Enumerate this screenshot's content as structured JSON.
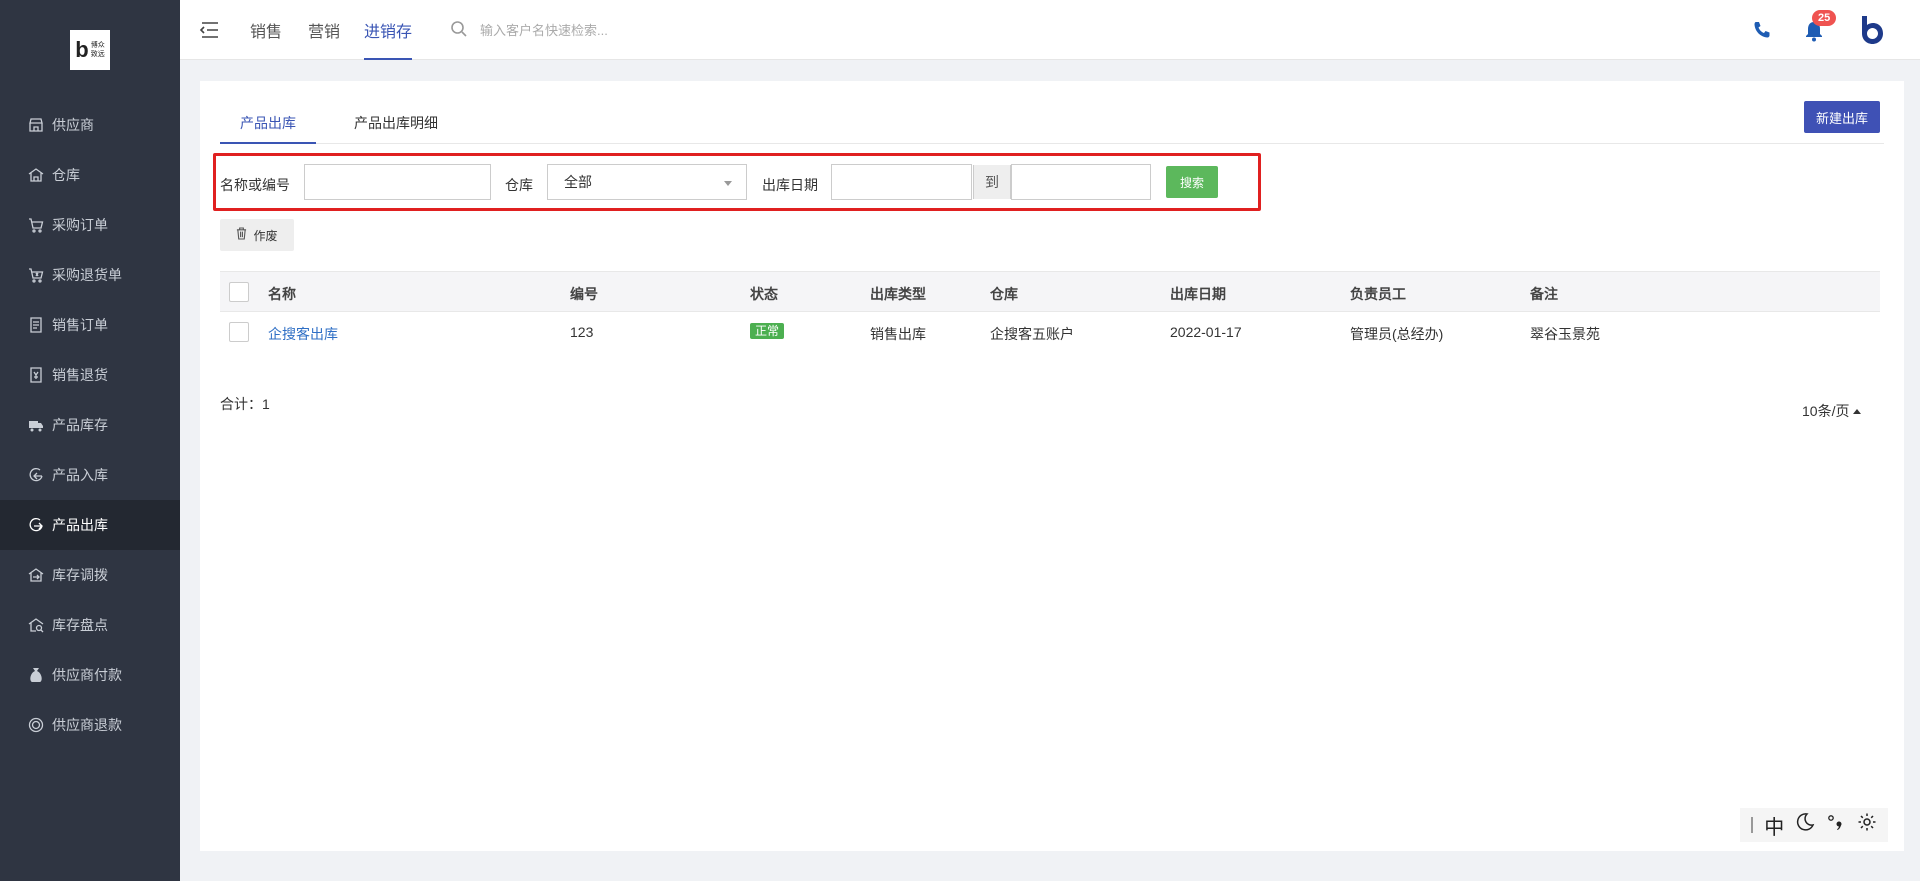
{
  "logo": {
    "letter": "b",
    "line1": "博众",
    "line2": "致远"
  },
  "sidebar": {
    "items": [
      {
        "label": "供应商",
        "icon": "store-icon"
      },
      {
        "label": "仓库",
        "icon": "warehouse-icon"
      },
      {
        "label": "采购订单",
        "icon": "cart-icon"
      },
      {
        "label": "采购退货单",
        "icon": "cart-return-icon"
      },
      {
        "label": "销售订单",
        "icon": "document-icon"
      },
      {
        "label": "销售退货",
        "icon": "receipt-return-icon"
      },
      {
        "label": "产品库存",
        "icon": "truck-icon"
      },
      {
        "label": "产品入库",
        "icon": "inbound-icon"
      },
      {
        "label": "产品出库",
        "icon": "outbound-icon"
      },
      {
        "label": "库存调拨",
        "icon": "transfer-icon"
      },
      {
        "label": "库存盘点",
        "icon": "inventory-check-icon"
      },
      {
        "label": "供应商付款",
        "icon": "money-bag-icon"
      },
      {
        "label": "供应商退款",
        "icon": "refund-icon"
      }
    ],
    "active_index": 8
  },
  "topbar": {
    "tabs": [
      "销售",
      "营销",
      "进销存"
    ],
    "active_tab": "进销存",
    "search_placeholder": "输入客户名快速检索...",
    "notification_count": "25"
  },
  "content": {
    "tabs": [
      "产品出库",
      "产品出库明细"
    ],
    "active_tab": "产品出库",
    "new_button": "新建出库",
    "filters": {
      "name_label": "名称或编号",
      "name_value": "",
      "warehouse_label": "仓库",
      "warehouse_value": "全部",
      "date_label": "出库日期",
      "date_from": "",
      "date_to": "",
      "to_label": "到",
      "search_button": "搜索"
    },
    "void_button": "作废",
    "table": {
      "columns": [
        "名称",
        "编号",
        "状态",
        "出库类型",
        "仓库",
        "出库日期",
        "负责员工",
        "备注"
      ],
      "rows": [
        {
          "name": "企搜客出库",
          "code": "123",
          "status": "正常",
          "type": "销售出库",
          "warehouse": "企搜客五账户",
          "date": "2022-01-17",
          "staff": "管理员(总经办)",
          "remark": "翠谷玉景苑"
        }
      ]
    },
    "total_label": "合计：",
    "total_value": "1",
    "page_size": "10条/页"
  },
  "ime": {
    "mode": "中"
  },
  "colors": {
    "accent": "#3f51b5",
    "sidebar_bg": "#2f3542",
    "success": "#5cb85c",
    "highlight_border": "#e02020"
  }
}
